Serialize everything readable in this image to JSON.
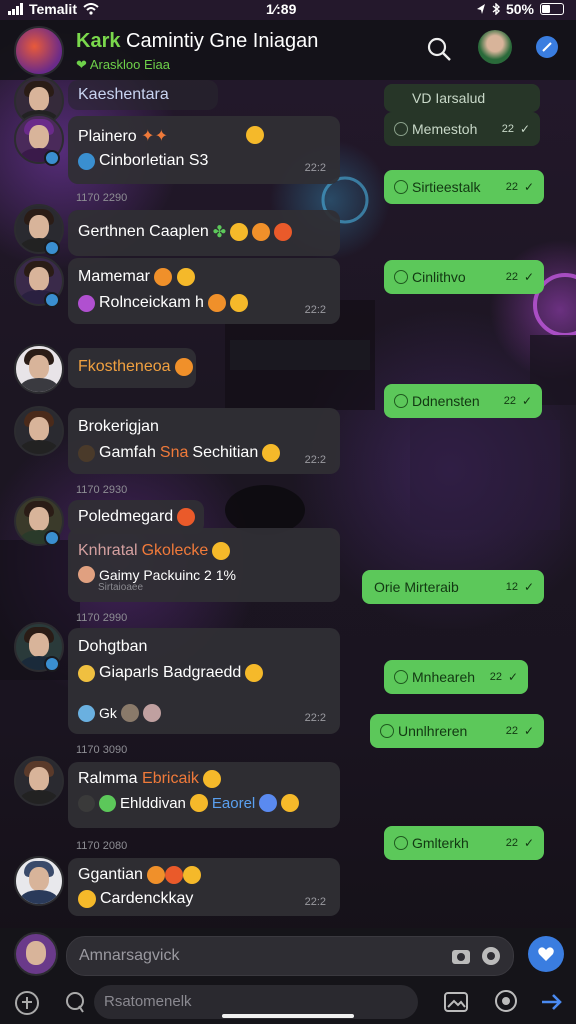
{
  "status_bar": {
    "carrier": "Temalit",
    "time": "1⁄:89",
    "battery": "50%"
  },
  "header": {
    "title_accent": "Kark",
    "title_rest": "Camintiy Gne Iniagan",
    "subtitle": "Araskloo Eiaa"
  },
  "messages": [
    {
      "name": "Kaeshentara",
      "line": "",
      "time": ""
    },
    {
      "name": "Plainero",
      "line": "Cinborletian S3",
      "time": "22:2"
    },
    {
      "name": "Gerthnen Caaplen",
      "line": "",
      "time": ""
    },
    {
      "name": "Mamemar",
      "line": "Rolnceickam h",
      "time": "22:2"
    },
    {
      "name": "Fkostheneoa",
      "line": "",
      "time": ""
    },
    {
      "name": "Brokerigjan",
      "line": "Gamfah",
      "line_accent": "Sna",
      "line_rest": "Sechitian",
      "time": "22:2"
    },
    {
      "name": "Poledmegard",
      "line": "Knhratal",
      "line_accent": "Gkolecke",
      "line2": "Gaimy Packuinc 2 1%",
      "line3": "Sirtaioaee",
      "time": ""
    },
    {
      "name": "Dohgtban",
      "line": "Giaparls Badgraedd",
      "line2": "Gk",
      "time": "22:2"
    },
    {
      "name": "Ralmma",
      "name_accent": "Ebricaik",
      "line": "Ehlddivan",
      "line_accent": "Eaorel",
      "time": "22:2"
    },
    {
      "name": "Ggantian",
      "line": "Cardenckkay",
      "time": "22:2"
    }
  ],
  "timestamps": [
    "1170 2290",
    "1170 2930",
    "1170 2990",
    "1170 3090",
    "1170 2080"
  ],
  "outgoing": [
    {
      "text": "VD Iarsalud",
      "time": ""
    },
    {
      "text": "Memestoh",
      "time": "22"
    },
    {
      "text": "Sirtieestalk",
      "time": "22"
    },
    {
      "text": "Cinlithvo",
      "time": "22"
    },
    {
      "text": "Ddnensten",
      "time": "22"
    },
    {
      "text": "Orie Mirteraib",
      "time": "12"
    },
    {
      "text": "Mnheareh",
      "time": "22"
    },
    {
      "text": "Unnlhreren",
      "time": "22"
    },
    {
      "text": "Gmlterkh",
      "time": "22"
    }
  ],
  "composer": {
    "placeholder": "Amnarsagvick",
    "secondary_placeholder": "Rsatomenelk"
  },
  "colors": {
    "accent_green": "#5cc85a",
    "brand_green": "#7ad84c",
    "send_blue": "#3a7de0",
    "accent_orange": "#f07a3a"
  }
}
